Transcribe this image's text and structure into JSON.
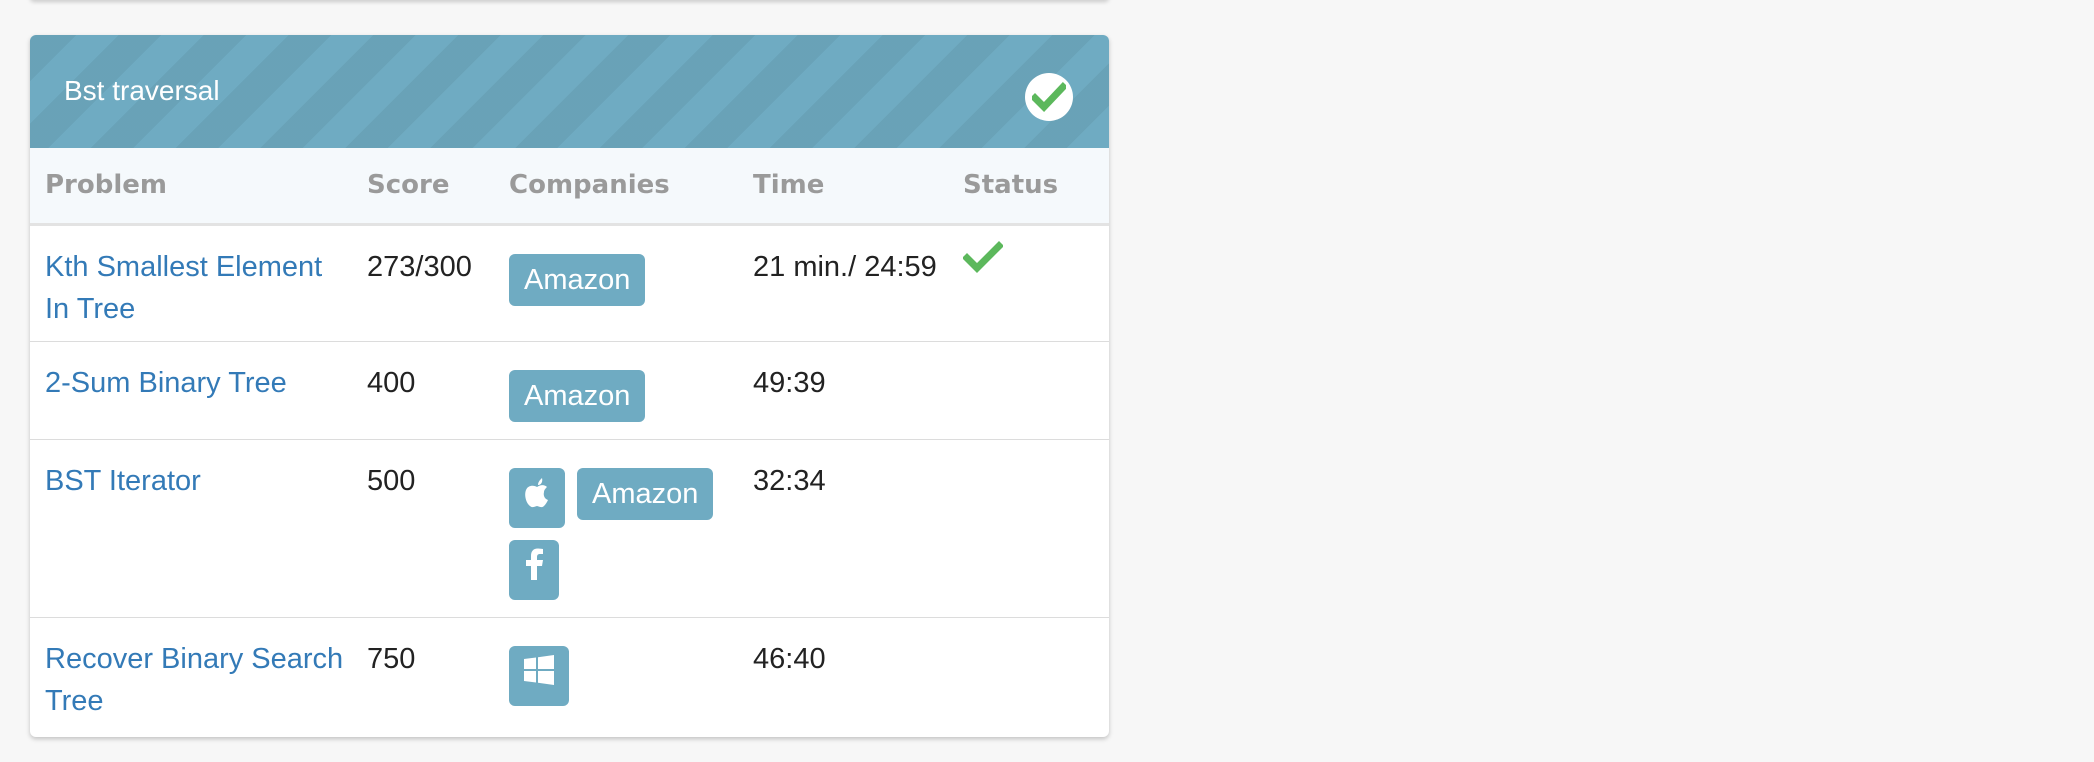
{
  "panel": {
    "title": "Bst traversal",
    "completed_icon": "check-circle-icon"
  },
  "table": {
    "headers": {
      "problem": "Problem",
      "score": "Score",
      "companies": "Companies",
      "time": "Time",
      "status": "Status"
    },
    "rows": [
      {
        "problem": "Kth Smallest Element In Tree",
        "score": "273/300",
        "companies": [
          {
            "type": "text",
            "label": "Amazon"
          }
        ],
        "time": "21 min./ 24:59",
        "status": "solved",
        "status_icon": "checkmark-icon"
      },
      {
        "problem": "2-Sum Binary Tree",
        "score": "400",
        "companies": [
          {
            "type": "text",
            "label": "Amazon"
          }
        ],
        "time": "49:39",
        "status": ""
      },
      {
        "problem": "BST Iterator",
        "score": "500",
        "companies": [
          {
            "type": "icon",
            "icon": "apple-icon"
          },
          {
            "type": "text",
            "label": "Amazon"
          },
          {
            "type": "icon",
            "icon": "facebook-icon"
          }
        ],
        "time": "32:34",
        "status": ""
      },
      {
        "problem": "Recover Binary Search Tree",
        "score": "750",
        "companies": [
          {
            "type": "icon",
            "icon": "windows-icon"
          }
        ],
        "time": "46:40",
        "status": ""
      }
    ]
  },
  "colors": {
    "header_bg": "#6fabc2",
    "tag_bg": "#6fabc2",
    "link": "#337ab7",
    "success": "#5cb85c"
  }
}
